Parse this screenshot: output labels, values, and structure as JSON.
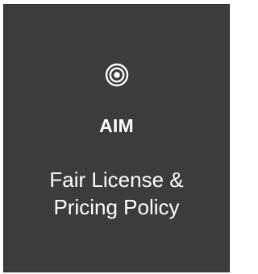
{
  "card": {
    "icon": "target-icon",
    "heading": "AIM",
    "lines": [
      "Fair License &",
      "Pricing Policy"
    ]
  },
  "colors": {
    "background": "#3c3c3c",
    "text": "#ffffff"
  }
}
